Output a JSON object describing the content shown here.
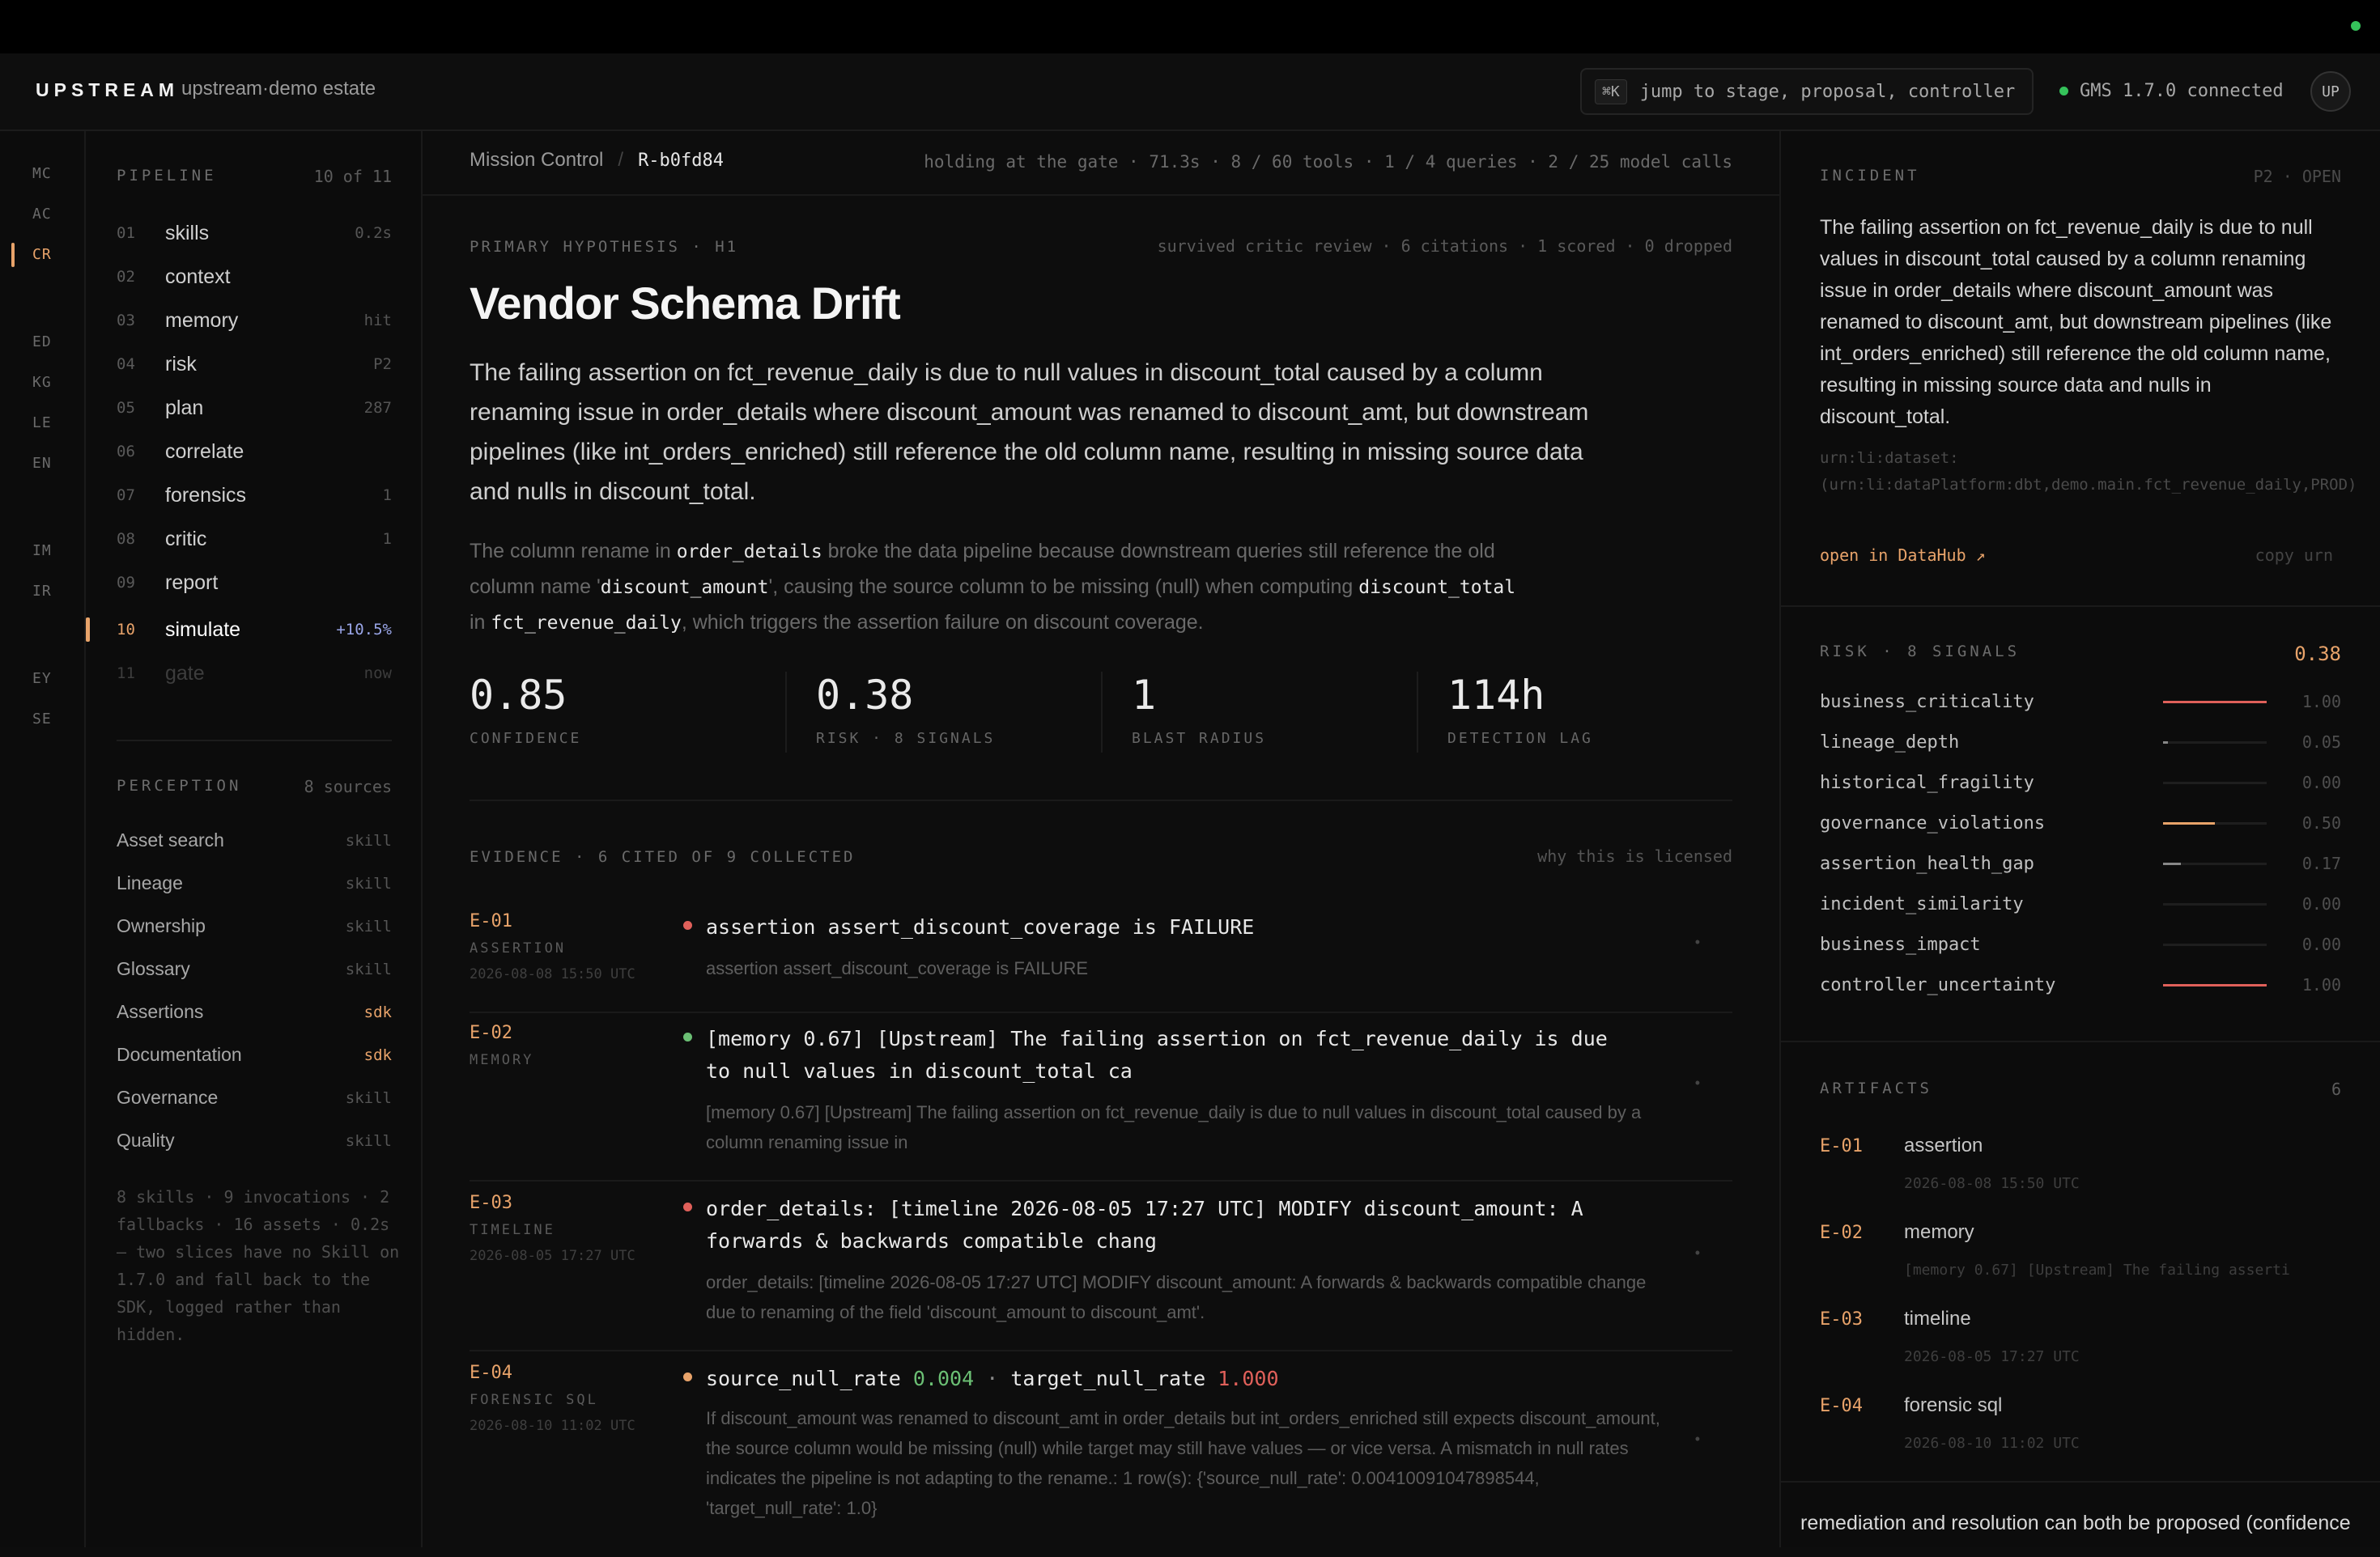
{
  "header": {
    "brand": "UPSTREAM",
    "estate": "upstream·demo estate",
    "cmdk_key": "⌘K",
    "search_placeholder": "jump to stage, proposal, controller",
    "gms_status": "GMS 1.7.0 connected",
    "avatar": "UP",
    "status_color": "#35c25a"
  },
  "rail": {
    "groups": [
      [
        "MC",
        "AC",
        "CR"
      ],
      [
        "ED",
        "KG",
        "LE",
        "EN"
      ],
      [
        "IM",
        "IR"
      ],
      [
        "EY",
        "SE"
      ]
    ],
    "active": "CR"
  },
  "pipeline": {
    "title": "PIPELINE",
    "count": "10 of 11",
    "items": [
      {
        "num": "01",
        "label": "skills",
        "meta": "0.2s"
      },
      {
        "num": "02",
        "label": "context",
        "meta": ""
      },
      {
        "num": "03",
        "label": "memory",
        "meta": "hit"
      },
      {
        "num": "04",
        "label": "risk",
        "meta": "P2"
      },
      {
        "num": "05",
        "label": "plan",
        "meta": "287"
      },
      {
        "num": "06",
        "label": "correlate",
        "meta": ""
      },
      {
        "num": "07",
        "label": "forensics",
        "meta": "1"
      },
      {
        "num": "08",
        "label": "critic",
        "meta": "1"
      },
      {
        "num": "09",
        "label": "report",
        "meta": ""
      },
      {
        "num": "10",
        "label": "simulate",
        "meta": "+10.5%"
      },
      {
        "num": "11",
        "label": "gate",
        "meta": "now"
      }
    ]
  },
  "perception": {
    "title": "PERCEPTION",
    "count": "8 sources",
    "items": [
      {
        "label": "Asset search",
        "tag": "skill"
      },
      {
        "label": "Lineage",
        "tag": "skill"
      },
      {
        "label": "Ownership",
        "tag": "skill"
      },
      {
        "label": "Glossary",
        "tag": "skill"
      },
      {
        "label": "Assertions",
        "tag": "sdk"
      },
      {
        "label": "Documentation",
        "tag": "sdk"
      },
      {
        "label": "Governance",
        "tag": "skill"
      },
      {
        "label": "Quality",
        "tag": "skill"
      }
    ],
    "note": "8 skills · 9 invocations · 2 fallbacks · 16 assets · 0.2s — two slices have no Skill on 1.7.0 and fall back to the SDK, logged rather than hidden."
  },
  "main": {
    "crumb_root": "Mission Control",
    "crumb_sep": "/",
    "crumb_id": "R-b0fd84",
    "status": "holding at the gate · 71.3s · 8 / 60 tools · 1 / 4 queries · 2 / 25 model calls",
    "hyp_label": "PRIMARY HYPOTHESIS · H1",
    "hyp_meta": "survived critic review · 6 citations · 1 scored · 0 dropped",
    "title": "Vendor Schema Drift",
    "lead": "The failing assertion on fct_revenue_daily is due to null values in discount_total caused by a column renaming issue in order_details where discount_amount was renamed to discount_amt, but downstream pipelines (like int_orders_enriched) still reference the old column name, resulting in missing source data and nulls in discount_total.",
    "sub": {
      "t1": "The column rename in ",
      "c1": "order_details",
      "t2": " broke the data pipeline because downstream queries still reference the old column name '",
      "c2": "discount_amount",
      "t3": "', causing the source column to be missing (null) when computing ",
      "c3": "discount_total",
      "t4": " in ",
      "c4": "fct_revenue_daily",
      "t5": ", which triggers the assertion failure on discount coverage."
    },
    "metrics": [
      {
        "value": "0.85",
        "caption": "CONFIDENCE"
      },
      {
        "value": "0.38",
        "caption": "RISK · 8 SIGNALS"
      },
      {
        "value": "1",
        "caption": "BLAST RADIUS"
      },
      {
        "value": "114h",
        "caption": "DETECTION LAG"
      }
    ],
    "evidence_head": "EVIDENCE · 6 CITED OF 9 COLLECTED",
    "evidence_why": "why this is licensed",
    "evidence": [
      {
        "id": "E-01",
        "kind": "ASSERTION",
        "time": "2026-08-08 15:50 UTC",
        "dot": "#e0605a",
        "title": "assertion assert_discount_coverage is FAILURE",
        "desc": "assertion assert_discount_coverage is FAILURE"
      },
      {
        "id": "E-02",
        "kind": "MEMORY",
        "time": "",
        "dot": "#6bbf74",
        "title": "[memory 0.67] [Upstream] The failing assertion on fct_revenue_daily is due to null values in discount_total ca",
        "desc": "[memory 0.67] [Upstream] The failing assertion on fct_revenue_daily is due to null values in discount_total caused by a column renaming issue in"
      },
      {
        "id": "E-03",
        "kind": "TIMELINE",
        "time": "2026-08-05 17:27 UTC",
        "dot": "#e0605a",
        "title": "order_details: [timeline 2026-08-05 17:27 UTC] MODIFY discount_amount: A forwards & backwards compatible chang",
        "desc": "order_details: [timeline 2026-08-05 17:27 UTC] MODIFY discount_amount: A forwards & backwards compatible change due to renaming of the field 'discount_amount to discount_amt'."
      },
      {
        "id": "E-04",
        "kind": "FORENSIC SQL",
        "time": "2026-08-10 11:02 UTC",
        "dot": "#e8a36a",
        "sql": {
          "k1": "source_null_rate",
          "v1": "0.004",
          "sep": "·",
          "k2": "target_null_rate",
          "v2": "1.000"
        },
        "desc": "If discount_amount was renamed to discount_amt in order_details but int_orders_enriched still expects discount_amount, the source column would be missing (null) while target may still have values — or vice versa. A mismatch in null rates indicates the pipeline is not adapting to the rename.: 1 row(s): {'source_null_rate': 0.00410091047898544, 'target_null_rate': 1.0}"
      }
    ],
    "row_mark": "•"
  },
  "incident": {
    "title": "INCIDENT",
    "badge": "P2 · OPEN",
    "text": "The failing assertion on fct_revenue_daily is due to null values in discount_total caused by a column renaming issue in order_details where discount_amount was renamed to discount_amt, but downstream pipelines (like int_orders_enriched) still reference the old column name, resulting in missing source data and nulls in discount_total.",
    "urn": "urn:li:dataset:(urn:li:dataPlatform:dbt,demo.main.fct_revenue_daily,PROD)",
    "open_link": "open in DataHub ↗",
    "copy": "copy urn"
  },
  "risk": {
    "title": "RISK · 8 SIGNALS",
    "score": "0.38",
    "signals": [
      {
        "name": "business_criticality",
        "value": "1.00",
        "level": 1.0,
        "color": "#e0605a"
      },
      {
        "name": "lineage_depth",
        "value": "0.05",
        "level": 0.05,
        "color": "#888888"
      },
      {
        "name": "historical_fragility",
        "value": "0.00",
        "level": 0.0,
        "color": "#888888"
      },
      {
        "name": "governance_violations",
        "value": "0.50",
        "level": 0.5,
        "color": "#e8a36a"
      },
      {
        "name": "assertion_health_gap",
        "value": "0.17",
        "level": 0.17,
        "color": "#888888"
      },
      {
        "name": "incident_similarity",
        "value": "0.00",
        "level": 0.0,
        "color": "#888888"
      },
      {
        "name": "business_impact",
        "value": "0.00",
        "level": 0.0,
        "color": "#888888"
      },
      {
        "name": "controller_uncertainty",
        "value": "1.00",
        "level": 1.0,
        "color": "#e0605a"
      }
    ]
  },
  "artifacts": {
    "title": "ARTIFACTS",
    "count": "6",
    "items": [
      {
        "id": "E-01",
        "kind": "assertion",
        "sub": "2026-08-08 15:50 UTC"
      },
      {
        "id": "E-02",
        "kind": "memory",
        "sub": "[memory 0.67] [Upstream] The failing asserti"
      },
      {
        "id": "E-03",
        "kind": "timeline",
        "sub": "2026-08-05 17:27 UTC"
      },
      {
        "id": "E-04",
        "kind": "forensic sql",
        "sub": "2026-08-10 11:02 UTC"
      }
    ]
  },
  "footer_text": "remediation and resolution can both be proposed (confidence"
}
